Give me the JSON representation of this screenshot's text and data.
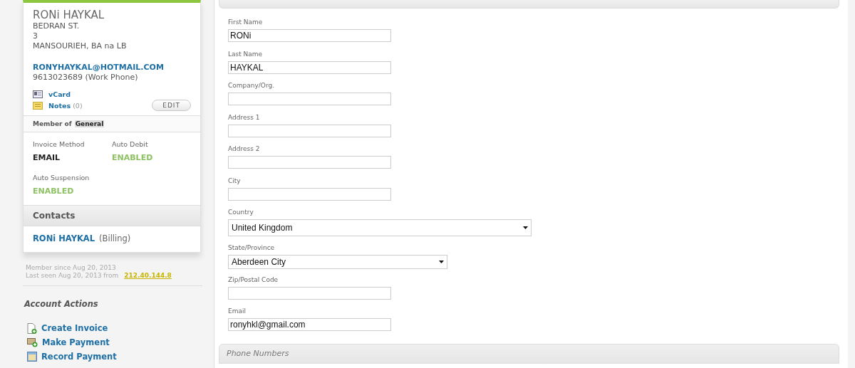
{
  "contact_card": {
    "name": "RONi HAYKAL",
    "address_lines": [
      "BEDRAN ST.",
      "3",
      "MANSOURIEH, BA na LB"
    ],
    "email": "RONYHAYKAL@HOTMAIL.COM",
    "phone": "9613023689 (Work Phone)",
    "vcard_link": "vCard",
    "notes_link": "Notes",
    "notes_count": "(0)",
    "edit_button": "EDIT"
  },
  "membership": {
    "label": "Member of",
    "group": "General"
  },
  "settings": [
    {
      "label": "Invoice Method",
      "value": "EMAIL",
      "enabled": false
    },
    {
      "label": "Auto Debit",
      "value": "ENABLED",
      "enabled": true
    },
    {
      "label": "Auto Suspension",
      "value": "ENABLED",
      "enabled": true
    }
  ],
  "contacts": {
    "title": "Contacts",
    "items": [
      {
        "name": "RONi HAYKAL",
        "role": "(Billing)"
      }
    ]
  },
  "member_since": "Member since Aug 20, 2013",
  "last_seen": "Last seen Aug 20, 2013 from",
  "ip": "212.40.144.8",
  "account_actions": {
    "title": "Account Actions",
    "items": [
      {
        "label": "Create Invoice",
        "kind": "invoice"
      },
      {
        "label": "Make Payment",
        "kind": "make"
      },
      {
        "label": "Record Payment",
        "kind": "record"
      }
    ]
  },
  "form": {
    "fields": [
      {
        "kind": "text",
        "label": "First Name",
        "value": "RONi"
      },
      {
        "kind": "text",
        "label": "Last Name",
        "value": "HAYKAL"
      },
      {
        "kind": "text",
        "label": "Company/Org."
      },
      {
        "kind": "text",
        "label": "Address 1"
      },
      {
        "kind": "text",
        "label": "Address 2"
      },
      {
        "kind": "text",
        "label": "City"
      },
      {
        "kind": "wideselect",
        "label": "Country",
        "value": "United Kingdom"
      },
      {
        "kind": "select",
        "label": "State/Province",
        "value": "Aberdeen City"
      },
      {
        "kind": "text",
        "label": "Zip/Postal Code"
      },
      {
        "kind": "text",
        "label": "Email",
        "value": "ronyhkl@gmail.com"
      }
    ]
  },
  "phone_section": {
    "title": "Phone Numbers"
  }
}
